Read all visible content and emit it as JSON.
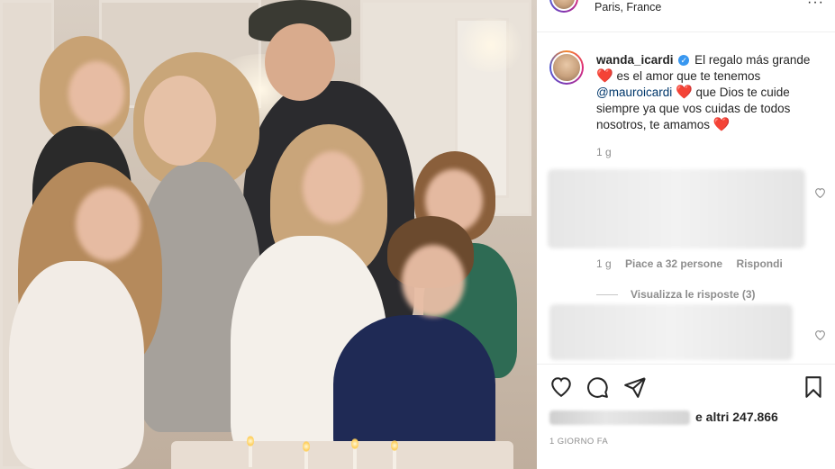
{
  "post": {
    "location": "Paris, France",
    "more_icon": "more-horizontal-icon"
  },
  "caption": {
    "username": "wanda_icardi",
    "verified_icon": "verified-badge-icon",
    "text_part1": "El regalo más grande",
    "heart1": "❤️",
    "text_part2": "es el amor que te tenemos",
    "mention": "@mauroicardi",
    "heart2": "❤️",
    "text_part3": "que Dios te cuide siempre ya que vos cuidas de todos nosotros, te amamos",
    "heart3": "❤️",
    "time": "1 g"
  },
  "comment": {
    "time": "1 g",
    "likes": "Piace a 32 persone",
    "reply": "Rispondi",
    "view_replies": "Visualizza le risposte (3)",
    "like_icon": "heart-outline-icon"
  },
  "actions": {
    "like_icon": "heart-outline-icon",
    "comment_icon": "comment-bubble-icon",
    "share_icon": "paper-plane-icon",
    "save_icon": "bookmark-icon"
  },
  "likes": {
    "text": "e altri 247.866"
  },
  "post_age": "1 GIORNO FA",
  "colors": {
    "text": "#262626",
    "muted": "#8e8e8e",
    "verified": "#3897f0",
    "heart": "#e0252b",
    "mention": "#00376b"
  }
}
